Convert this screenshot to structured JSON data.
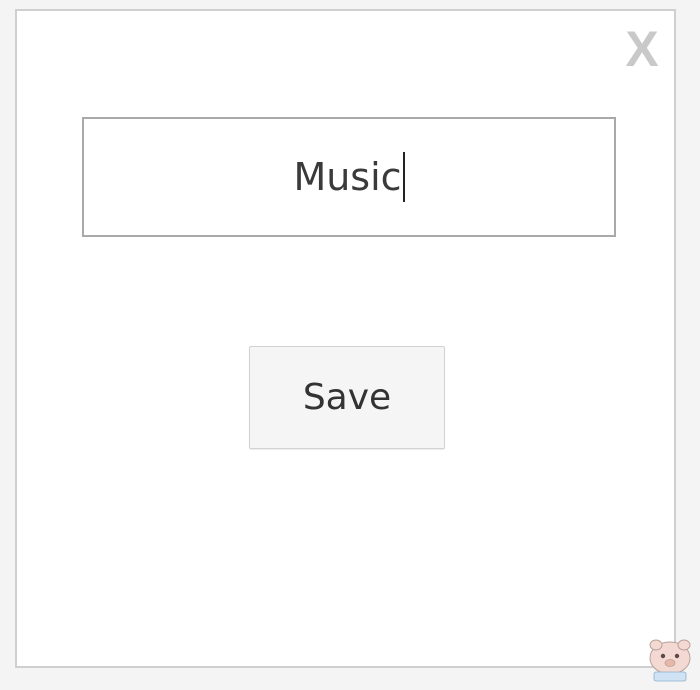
{
  "dialog": {
    "close_label": "X",
    "input_value": "Music",
    "save_label": "Save"
  },
  "colors": {
    "dialog_border": "#cfcfcf",
    "input_border": "#a9a9a9",
    "button_bg": "#f5f5f5",
    "close_icon": "#c9c9c9"
  }
}
